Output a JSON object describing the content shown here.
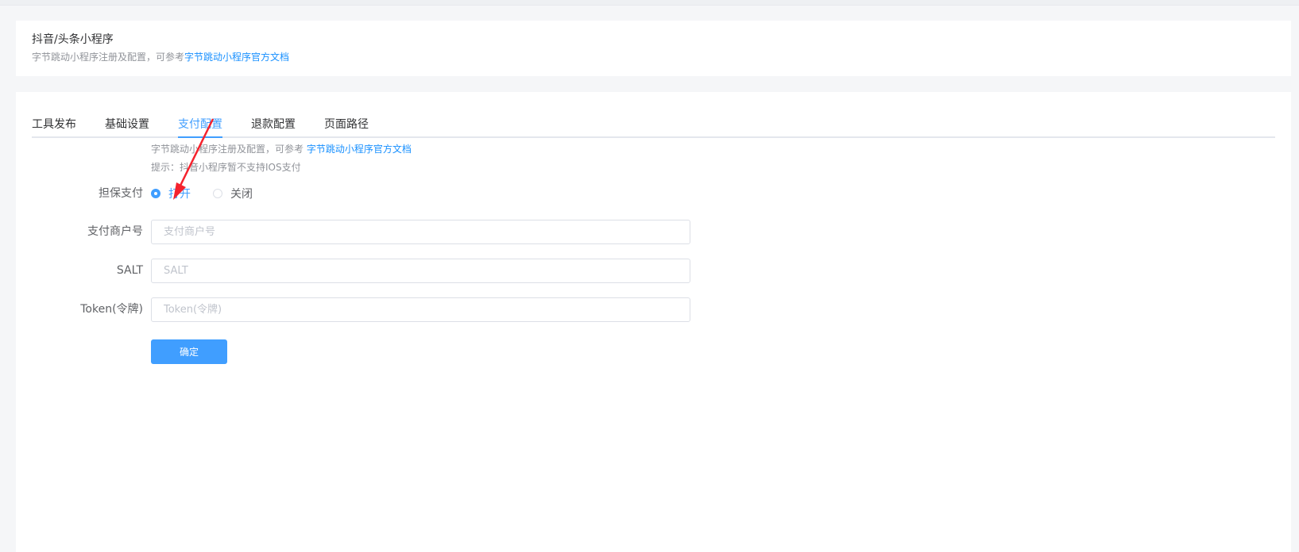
{
  "header": {
    "title": "抖音/头条小程序",
    "description_prefix": "字节跳动小程序注册及配置，可参考",
    "doc_link": "字节跳动小程序官方文档"
  },
  "tabs": [
    {
      "label": "工具发布",
      "active": false
    },
    {
      "label": "基础设置",
      "active": false
    },
    {
      "label": "支付配置",
      "active": true
    },
    {
      "label": "退款配置",
      "active": false
    },
    {
      "label": "页面路径",
      "active": false
    }
  ],
  "notes": {
    "intro_prefix": "字节跳动小程序注册及配置，可参考 ",
    "intro_link": "字节跳动小程序官方文档",
    "tip": "提示：抖音小程序暂不支持IOS支付"
  },
  "form": {
    "guarantee_pay": {
      "label": "担保支付",
      "options": [
        {
          "label": "打开",
          "checked": true
        },
        {
          "label": "关闭",
          "checked": false
        }
      ]
    },
    "merchant_id": {
      "label": "支付商户号",
      "placeholder": "支付商户号",
      "value": ""
    },
    "salt": {
      "label": "SALT",
      "placeholder": "SALT",
      "value": ""
    },
    "token": {
      "label": "Token(令牌)",
      "placeholder": "Token(令牌)",
      "value": ""
    },
    "submit_label": "确定"
  },
  "colors": {
    "accent": "#409eff",
    "link": "#1890ff",
    "annotation_arrow": "#f5222d"
  }
}
